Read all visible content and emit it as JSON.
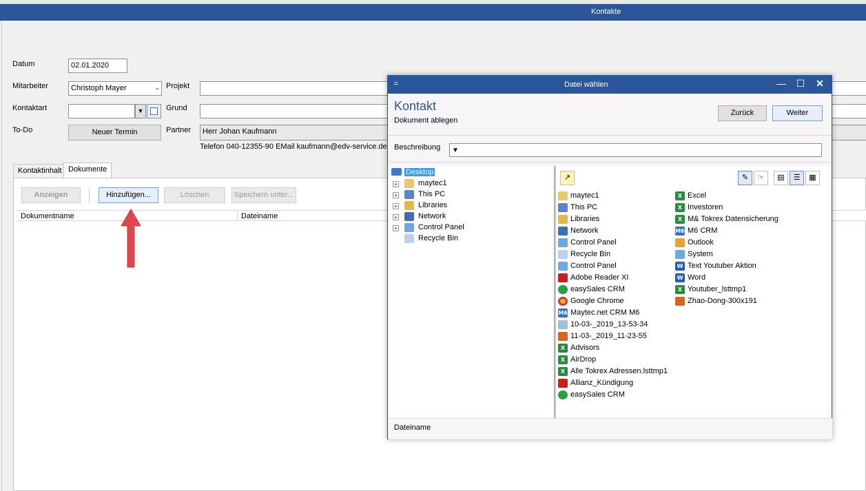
{
  "main": {
    "title": "Kontakte",
    "form": {
      "datum_label": "Datum",
      "datum_value": "02.01.2020",
      "mitarbeiter_label": "Mitarbeiter",
      "mitarbeiter_value": "Christoph Mayer",
      "projekt_label": "Projekt",
      "kontaktart_label": "Kontaktart",
      "grund_label": "Grund",
      "todo_label": "To-Do",
      "neuer_termin": "Neuer Termin",
      "partner_label": "Partner",
      "partner_value": "Herr Johan Kaufmann",
      "partner_info": "Telefon 040-12355-90  EMail kaufmann@edv-service.de"
    },
    "tabs": [
      {
        "label": "Kontaktinhalt"
      },
      {
        "label": "Dokumente"
      }
    ],
    "toolbar": {
      "anzeigen": "Anzeigen",
      "hinzufuegen": "Hinzufügen...",
      "loeschen": "Löschen",
      "speichern": "Speichern unter..."
    },
    "columns": [
      "Dokumentname",
      "Dateiname"
    ]
  },
  "dialog": {
    "menu_glyph": "=",
    "title": "Datei wählen",
    "controls": {
      "minimize": "—",
      "maximize": "☐",
      "close": "✕"
    },
    "heading": "Kontakt",
    "subheading": "Dokument ablegen",
    "back": "Zurück",
    "next": "Weiter",
    "beschreibung_label": "Beschreibung",
    "beschreibung_value": "",
    "tree": [
      {
        "label": "Desktop"
      },
      {
        "label": "maytec1"
      },
      {
        "label": "This PC"
      },
      {
        "label": "Libraries"
      },
      {
        "label": "Network"
      },
      {
        "label": "Control Panel"
      },
      {
        "label": "Recycle Bin"
      }
    ],
    "files_col1": [
      {
        "label": "maytec1"
      },
      {
        "label": "This PC"
      },
      {
        "label": "Libraries"
      },
      {
        "label": "Network"
      },
      {
        "label": "Control Panel"
      },
      {
        "label": "Recycle Bin"
      },
      {
        "label": "Control Panel"
      },
      {
        "label": "Adobe Reader XI"
      },
      {
        "label": "easySales CRM"
      },
      {
        "label": "Google Chrome"
      },
      {
        "label": "Maytec.net CRM M6"
      },
      {
        "label": "10-03-_2019_13-53-34"
      },
      {
        "label": "11-03-_2019_11-23-55"
      },
      {
        "label": "Advisors"
      },
      {
        "label": "AirDrop"
      },
      {
        "label": "Alle Tokrex Adressen.lsttmp1"
      },
      {
        "label": "Allianz_Kündigung"
      },
      {
        "label": "easySales CRM"
      }
    ],
    "files_col2": [
      {
        "label": "Excel"
      },
      {
        "label": "Investoren"
      },
      {
        "label": "M& Tokrex Datensicherung"
      },
      {
        "label": "M6 CRM"
      },
      {
        "label": "Outlook"
      },
      {
        "label": "System"
      },
      {
        "label": "Text Youtuber Aktion"
      },
      {
        "label": "Word"
      },
      {
        "label": "Youtuber_lsttmp1"
      },
      {
        "label": "Zhao-Dong-300x191"
      }
    ],
    "footer_label": "Dateiname"
  },
  "colors": {
    "accent": "#2b579a",
    "arrow": "#e0474c"
  }
}
